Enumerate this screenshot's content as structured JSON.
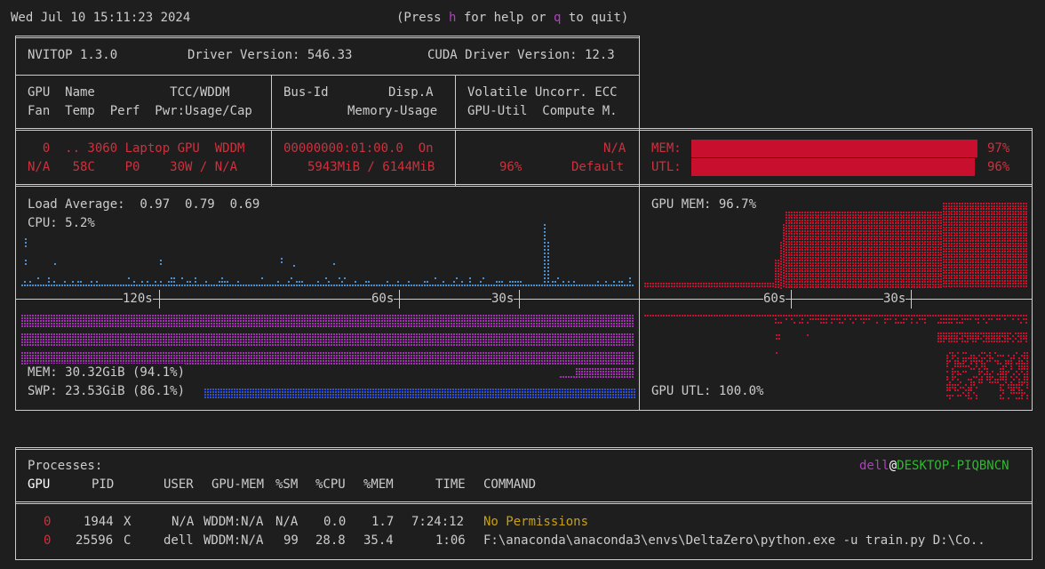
{
  "header": {
    "datetime": "Wed Jul 10 15:11:23 2024",
    "help_pre": "(Press ",
    "help_key": "h",
    "help_mid": " for help or ",
    "quit_key": "q",
    "help_post": " to quit)"
  },
  "device_panel": {
    "nvitop": "NVITOP 1.3.0",
    "driver": "Driver Version: 546.33",
    "cuda": "CUDA Driver Version: 12.3",
    "col1_line1": "GPU  Name          TCC/WDDM",
    "col1_line2": "Fan  Temp  Perf  Pwr:Usage/Cap",
    "col2_line1": "Bus-Id        Disp.A",
    "col2_line2": "Memory-Usage",
    "col3_line1": "Volatile Uncorr. ECC",
    "col3_line2": "GPU-Util  Compute M."
  },
  "gpu": {
    "row1_col1": "  0  .. 3060 Laptop GPU  WDDM",
    "row1_col2": "00000000:01:00.0  On",
    "row1_col3": "N/A",
    "row2_col1": "N/A   58C    P0    30W / N/A",
    "row2_col2": "5943MiB / 6144MiB",
    "row2_util": "96%",
    "row2_compute": "Default",
    "mem_label": "MEM:",
    "mem_pct": "97%",
    "mem_fraction": 0.97,
    "utl_label": "UTL:",
    "utl_pct": "96%",
    "utl_fraction": 0.96,
    "bar_color": "#c8102e"
  },
  "host": {
    "load_average": "Load Average:  0.97  0.79  0.69",
    "cpu": "CPU: 5.2%",
    "mem": "MEM: 30.32GiB (94.1%)",
    "swp": "SWP: 23.53GiB (86.1%)",
    "axis_left": [
      "120s",
      "60s",
      "30s"
    ],
    "gpu_mem": "GPU MEM: 96.7%",
    "gpu_utl": "GPU UTL: 100.0%",
    "axis_right": [
      "60s",
      "30s"
    ],
    "cpu_color": "#4a90d0",
    "mem_color": "#a030b0",
    "swp_color": "#3050d0",
    "gpu_color": "#c8102e"
  },
  "processes": {
    "title": "Processes:",
    "user": "dell",
    "at": "@",
    "host": "DESKTOP-PIQBNCN",
    "headers": [
      "GPU",
      "PID",
      "USER",
      "GPU-MEM",
      "%SM",
      "%CPU",
      "%MEM",
      "TIME",
      "COMMAND"
    ],
    "rows": [
      {
        "gpu": "0",
        "pid": "1944",
        "type": "X",
        "user": "N/A",
        "gpu_mem": "WDDM:N/A",
        "sm": "N/A",
        "cpu": "0.0",
        "mem": "1.7",
        "time": "7:24:12",
        "command": "No Permissions"
      },
      {
        "gpu": "0",
        "pid": "25596",
        "type": "C",
        "user": "dell",
        "gpu_mem": "WDDM:N/A",
        "sm": "99",
        "cpu": "28.8",
        "mem": "35.4",
        "time": "1:06",
        "command": "F:\\anaconda\\anaconda3\\envs\\DeltaZero\\python.exe -u train.py D:\\Co.."
      }
    ]
  }
}
